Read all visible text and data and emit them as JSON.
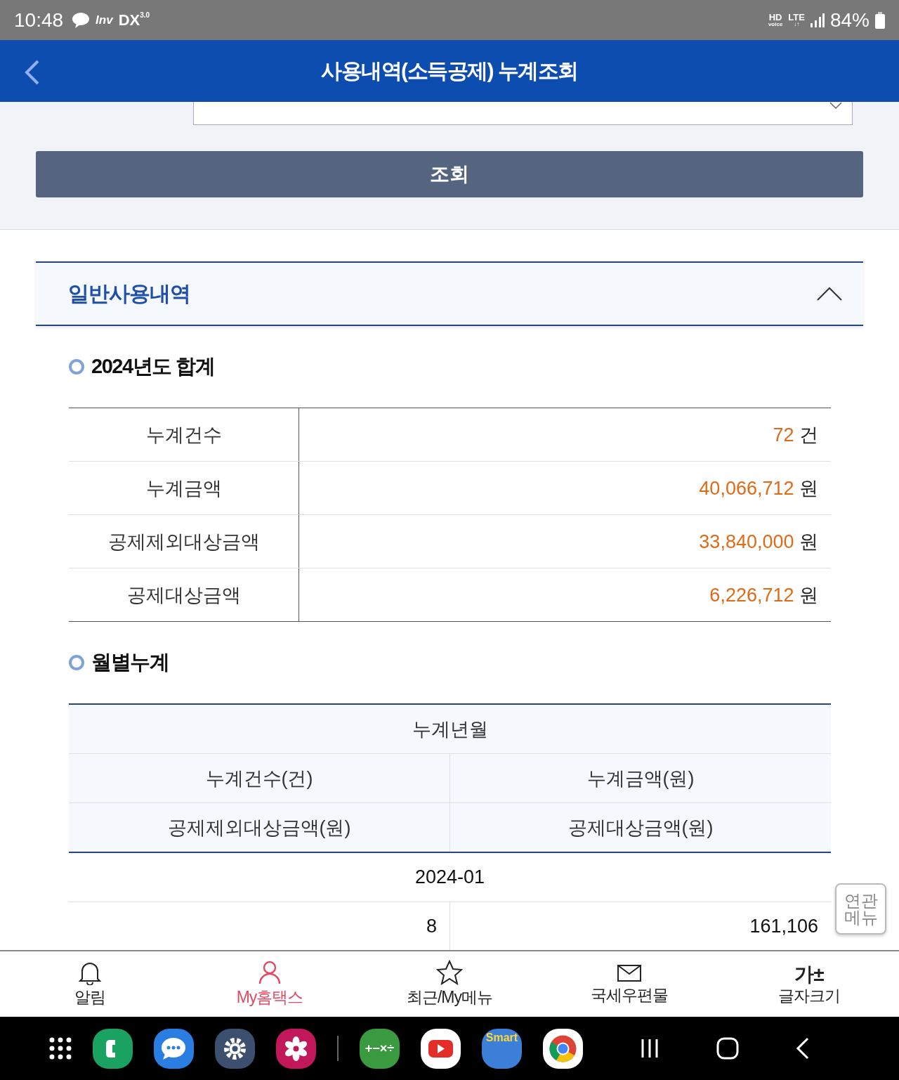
{
  "status_bar": {
    "time": "10:48",
    "apps": [
      {
        "kind": "talk"
      },
      {
        "kind": "inv",
        "text": "Inv"
      },
      {
        "kind": "dx",
        "text": "DX",
        "sup": "3.0"
      }
    ],
    "network": [
      {
        "top": "HD",
        "bottom": "voice"
      },
      {
        "top": "LTE",
        "bottom": "↓↑"
      }
    ],
    "battery": "84%"
  },
  "header": {
    "title": "사용내역(소득공제) 누계조회"
  },
  "search": {
    "button": "조회"
  },
  "accordion": {
    "title": "일반사용내역",
    "expanded": true
  },
  "summary": {
    "title": "2024년도 합계",
    "rows": [
      {
        "label": "누계건수",
        "value": "72",
        "unit": "건"
      },
      {
        "label": "누계금액",
        "value": "40,066,712",
        "unit": "원"
      },
      {
        "label": "공제제외대상금액",
        "value": "33,840,000",
        "unit": "원"
      },
      {
        "label": "공제대상금액",
        "value": "6,226,712",
        "unit": "원"
      }
    ]
  },
  "monthly": {
    "title": "월별누계",
    "header": [
      [
        "누계년월"
      ],
      [
        "누계건수(건)",
        "누계금액(원)"
      ],
      [
        "공제제외대상금액(원)",
        "공제대상금액(원)"
      ]
    ],
    "rows": [
      {
        "month": "2024-01",
        "cells": [
          "8",
          "161,106"
        ]
      }
    ]
  },
  "float_button": "연관 메뉴",
  "bottom_nav": [
    {
      "kind": "bell",
      "label": "알림",
      "selected": false
    },
    {
      "kind": "person",
      "label": "My홈택스",
      "selected": true
    },
    {
      "kind": "star",
      "label": "최근/My메뉴",
      "selected": false
    },
    {
      "kind": "mail",
      "label": "국세우편물",
      "selected": false
    },
    {
      "kind": "font",
      "label": "글자크기",
      "glyph": "가±",
      "selected": false
    }
  ],
  "dock": [
    {
      "kind": "grid"
    },
    {
      "kind": "phone"
    },
    {
      "kind": "chat"
    },
    {
      "kind": "settings"
    },
    {
      "kind": "flower"
    },
    {
      "kind": "sep"
    },
    {
      "kind": "calc",
      "text": "+−×÷"
    },
    {
      "kind": "play"
    },
    {
      "kind": "smart",
      "text": "Smart"
    },
    {
      "kind": "browser"
    },
    {
      "kind": "recents"
    },
    {
      "kind": "home"
    },
    {
      "kind": "back"
    }
  ]
}
